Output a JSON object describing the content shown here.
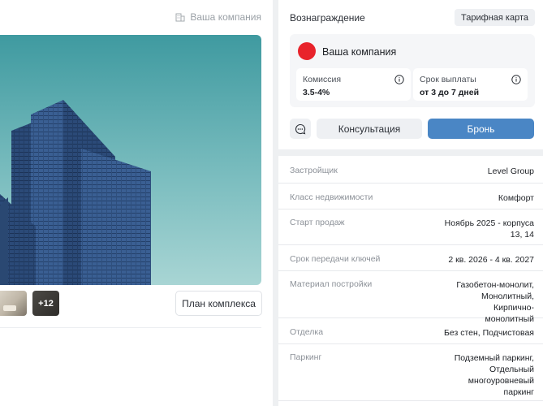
{
  "left": {
    "company_label": "Ваша компания",
    "thumbs_more": "+12",
    "plan_button": "План комплекса"
  },
  "reward": {
    "title": "Вознаграждение",
    "tariff_button": "Тарифная карта",
    "company_name": "Ваша компания",
    "commission_label": "Комиссия",
    "commission_value": "3.5-4%",
    "payout_label": "Срок выплаты",
    "payout_value": "от 3 до 7 дней",
    "consult_button": "Консультация",
    "book_button": "Бронь",
    "brand_color": "#e8232b",
    "accent_color": "#4a86c5"
  },
  "details": [
    {
      "key": "Застройщик",
      "value": "Level Group"
    },
    {
      "key": "Класс недвижимости",
      "value": "Комфорт"
    },
    {
      "key": "Старт продаж",
      "value": "Ноябрь 2025 - корпуса 13, 14"
    },
    {
      "key": "Срок передачи ключей",
      "value": "2 кв. 2026 - 4 кв. 2027"
    },
    {
      "key": "Материал постройки",
      "value": "Газобетон-монолит, Монолитный, Кирпично-монолитный"
    },
    {
      "key": "Отделка",
      "value": "Без стен, Подчистовая"
    },
    {
      "key": "Паркинг",
      "value": "Подземный паркинг, Отдельный многоуровневый паркинг"
    }
  ]
}
